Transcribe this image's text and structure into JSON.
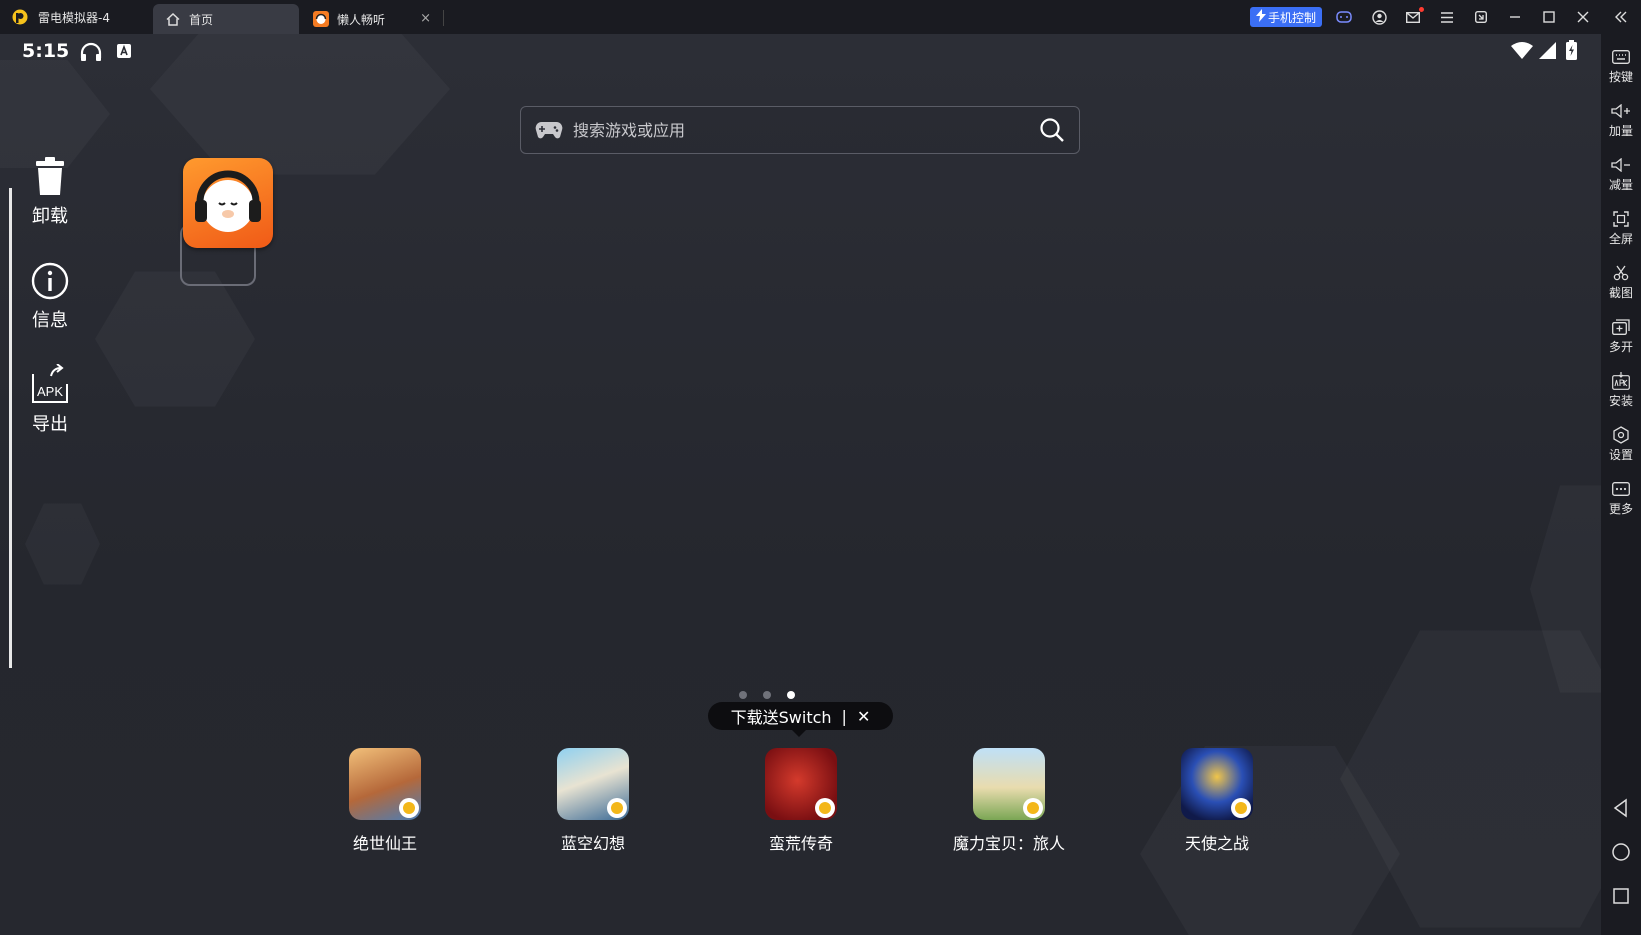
{
  "window": {
    "title": "雷电模拟器-4"
  },
  "tabs": [
    {
      "label": "首页",
      "icon": "home-icon"
    },
    {
      "label": "懒人畅听",
      "icon": "app-icon",
      "close": "×"
    }
  ],
  "titlebar": {
    "phone_control": "手机控制"
  },
  "status_bar": {
    "time": "5:15"
  },
  "search": {
    "placeholder": "搜索游戏或应用"
  },
  "side_actions": [
    {
      "label": "卸载",
      "icon": "trash-icon"
    },
    {
      "label": "信息",
      "icon": "info-icon"
    },
    {
      "label": "导出",
      "icon": "apk-export-icon",
      "icon_text": "APK"
    }
  ],
  "promo": {
    "text": "下载送Switch",
    "divider": "|",
    "close": "✕"
  },
  "dock": [
    {
      "label": "绝世仙王"
    },
    {
      "label": "蓝空幻想"
    },
    {
      "label": "蛮荒传奇"
    },
    {
      "label": "魔力宝贝：旅人"
    },
    {
      "label": "天使之战"
    }
  ],
  "right_toolbar": [
    {
      "label": "按键"
    },
    {
      "label": "加量"
    },
    {
      "label": "减量"
    },
    {
      "label": "全屏"
    },
    {
      "label": "截图"
    },
    {
      "label": "多开"
    },
    {
      "label": "安装"
    },
    {
      "label": "设置"
    },
    {
      "label": "更多"
    }
  ],
  "colors": {
    "accent": "#3b6ff5",
    "background": "#25272e",
    "app_orange": "#f47b22"
  }
}
